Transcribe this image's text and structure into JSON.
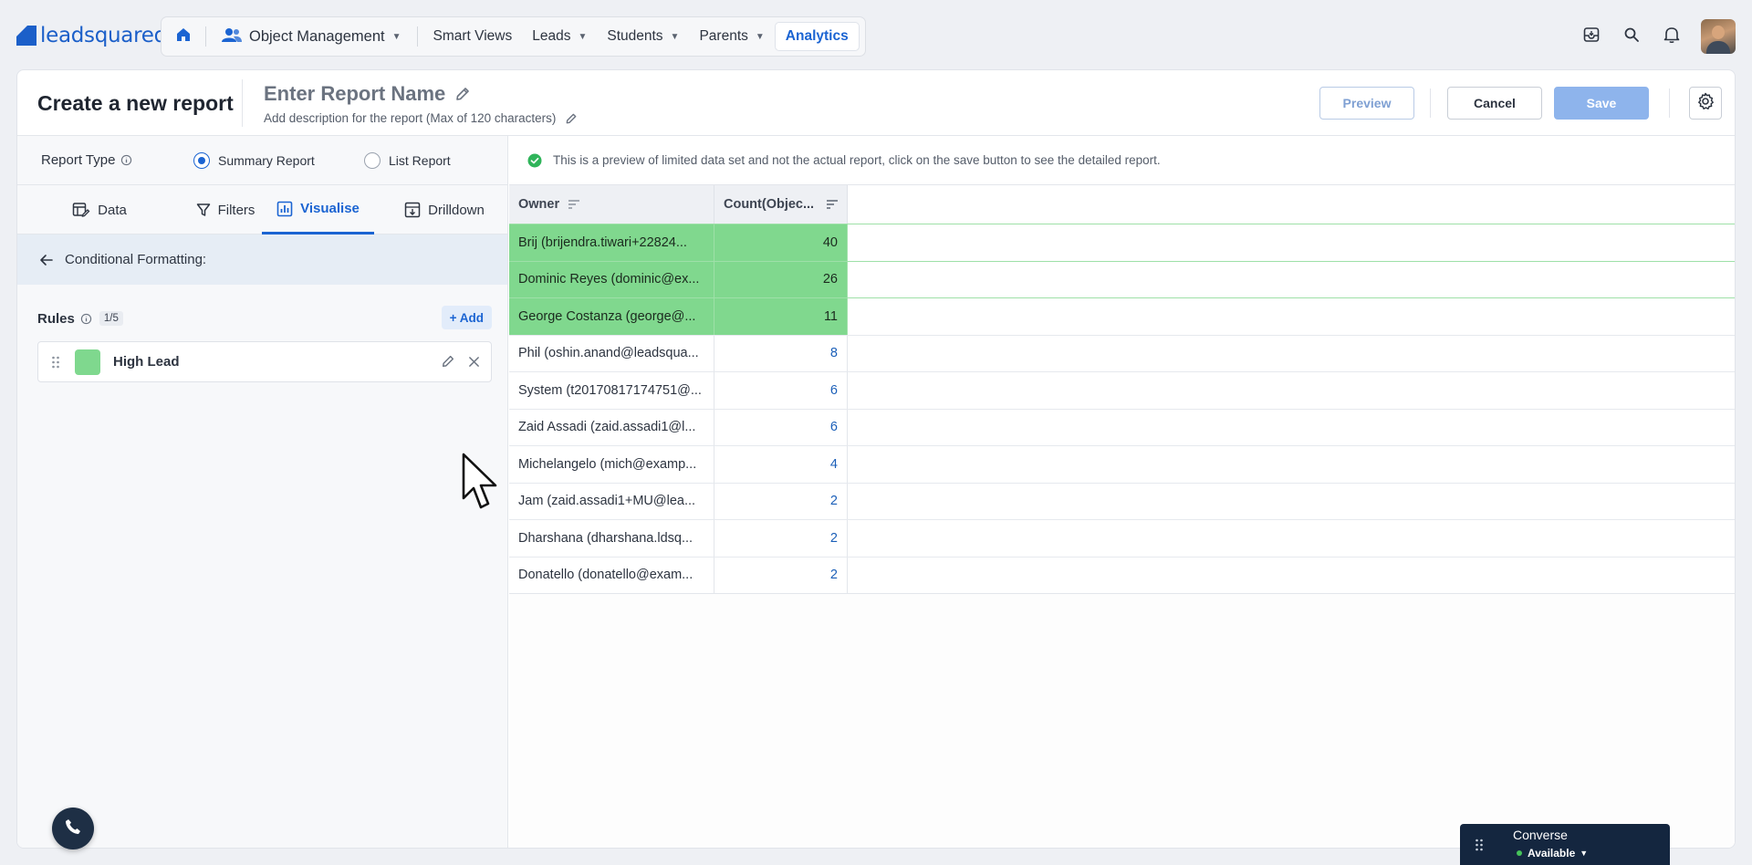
{
  "brand": {
    "name": "leadsquared",
    "color": "#1b5fc9"
  },
  "nav": {
    "items": [
      {
        "label": "Object Management",
        "has_menu": true
      },
      {
        "label": "Smart Views",
        "has_menu": false
      },
      {
        "label": "Leads",
        "has_menu": true
      },
      {
        "label": "Students",
        "has_menu": true
      },
      {
        "label": "Parents",
        "has_menu": true
      },
      {
        "label": "Analytics",
        "has_menu": false,
        "active": true
      }
    ]
  },
  "header": {
    "title": "Create a new report",
    "report_name_placeholder": "Enter Report Name",
    "description_placeholder": "Add description for the report (Max of 120 characters)",
    "preview_label": "Preview",
    "cancel_label": "Cancel",
    "save_label": "Save"
  },
  "left_panel": {
    "report_type_label": "Report Type",
    "report_types": [
      {
        "label": "Summary Report",
        "selected": true
      },
      {
        "label": "List Report",
        "selected": false
      }
    ],
    "tabs": [
      {
        "label": "Data",
        "icon": "data-icon"
      },
      {
        "label": "Filters",
        "icon": "filter-icon"
      },
      {
        "label": "Visualise",
        "icon": "chart-icon",
        "active": true
      },
      {
        "label": "Drilldown",
        "icon": "drilldown-icon"
      }
    ],
    "section_title": "Conditional Formatting:",
    "rules_label": "Rules",
    "rules_count": "1/5",
    "add_label": "+ Add",
    "rules": [
      {
        "name": "High Lead",
        "color": "#7fd88e"
      }
    ]
  },
  "preview": {
    "notice": "This is a preview of limited data set and not the actual report, click on the save button to see the detailed report.",
    "columns": [
      "Owner",
      "Count(Objec..."
    ],
    "rows": [
      {
        "owner": "Brij (brijendra.tiwari+22824...",
        "count": "40",
        "highlight": true
      },
      {
        "owner": "Dominic Reyes (dominic@ex...",
        "count": "26",
        "highlight": true
      },
      {
        "owner": "George Costanza (george@...",
        "count": "11",
        "highlight": true
      },
      {
        "owner": "Phil (oshin.anand@leadsqua...",
        "count": "8",
        "highlight": false
      },
      {
        "owner": "System (t20170817174751@...",
        "count": "6",
        "highlight": false
      },
      {
        "owner": "Zaid Assadi (zaid.assadi1@l...",
        "count": "6",
        "highlight": false
      },
      {
        "owner": "Michelangelo (mich@examp...",
        "count": "4",
        "highlight": false
      },
      {
        "owner": "Jam (zaid.assadi1+MU@lea...",
        "count": "2",
        "highlight": false
      },
      {
        "owner": "Dharshana (dharshana.ldsq...",
        "count": "2",
        "highlight": false
      },
      {
        "owner": "Donatello (donatello@exam...",
        "count": "2",
        "highlight": false
      }
    ],
    "highlight_color": "#80d88e"
  },
  "converse": {
    "title": "Converse",
    "status": "Available",
    "status_color": "#46c35a"
  },
  "colors": {
    "accent": "#1b64d2",
    "save_disabled": "#8eb4ec"
  }
}
